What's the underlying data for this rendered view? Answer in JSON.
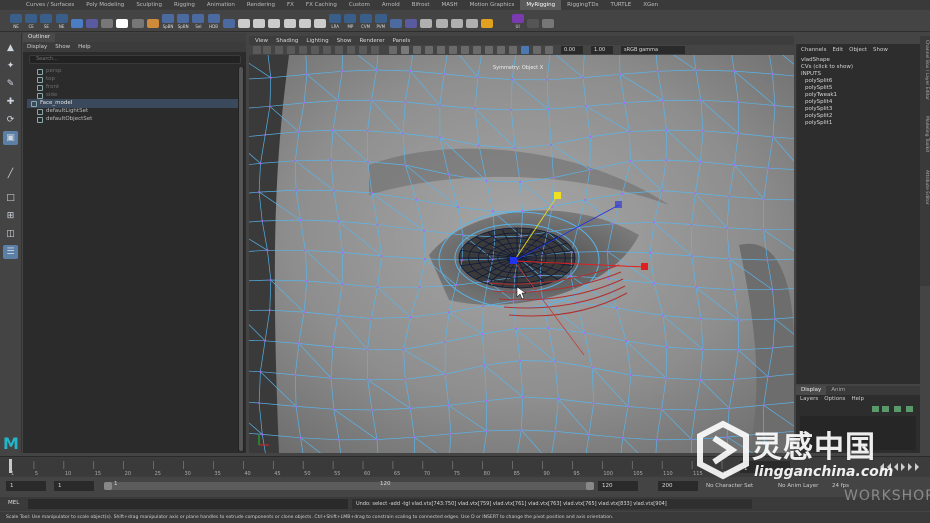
{
  "shelf_tabs": [
    "Curves / Surfaces",
    "Poly Modeling",
    "Sculpting",
    "Rigging",
    "Animation",
    "Rendering",
    "FX",
    "FX Caching",
    "Custom",
    "Arnold",
    "Bifrost",
    "MASH",
    "Motion Graphics",
    "MyRigging",
    "RiggingTDs",
    "TURTLE",
    "XGen"
  ],
  "shelf_active": "MyRigging",
  "shelf_icons": [
    {
      "label": "NE",
      "icon": "shelf-script-icon",
      "color": "#3a5e8a"
    },
    {
      "label": "CE",
      "icon": "shelf-script-icon",
      "color": "#3a5e8a"
    },
    {
      "label": "SE",
      "icon": "shelf-script-icon",
      "color": "#3a5e8a"
    },
    {
      "label": "NE",
      "icon": "shelf-script-icon",
      "color": "#3a5e8a"
    },
    {
      "label": "",
      "icon": "target-icon",
      "color": "#4b7dc4"
    },
    {
      "label": "",
      "icon": "grid-icon",
      "color": "#5a5aa0"
    },
    {
      "label": "",
      "icon": "checker-icon",
      "color": "#777777"
    },
    {
      "label": "",
      "icon": "dots-icon",
      "color": "#ffffff"
    },
    {
      "label": "",
      "icon": "checker-icon",
      "color": "#777777"
    },
    {
      "label": "",
      "icon": "joint-icon",
      "color": "#d08a3c"
    },
    {
      "label": "SpBN",
      "icon": "bone-icon",
      "color": "#4a6aa0"
    },
    {
      "label": "SpBN",
      "icon": "bone-icon",
      "color": "#4a6aa0"
    },
    {
      "label": "Sel",
      "icon": "select-icon",
      "color": "#4a6aa0"
    },
    {
      "label": "HDB",
      "icon": "bone-icon",
      "color": "#4a6aa0"
    },
    {
      "label": "",
      "icon": "bone-icon",
      "color": "#4a6aa0"
    },
    {
      "label": "",
      "icon": "tool-icon",
      "color": "#cccccc"
    },
    {
      "label": "",
      "icon": "tool-icon",
      "color": "#cccccc"
    },
    {
      "label": "",
      "icon": "tool-icon",
      "color": "#cccccc"
    },
    {
      "label": "",
      "icon": "tool-icon",
      "color": "#cccccc"
    },
    {
      "label": "",
      "icon": "tool-icon",
      "color": "#cccccc"
    },
    {
      "label": "",
      "icon": "tool-icon",
      "color": "#cccccc"
    },
    {
      "label": "LRA",
      "icon": "script-icon",
      "color": "#3a5e8a"
    },
    {
      "label": "MP",
      "icon": "script-icon",
      "color": "#3a5e8a"
    },
    {
      "label": "CVM",
      "icon": "script-icon",
      "color": "#3a5e8a"
    },
    {
      "label": "PVM",
      "icon": "script-icon",
      "color": "#3a5e8a"
    },
    {
      "label": "",
      "icon": "bone-icon",
      "color": "#4a6aa0"
    },
    {
      "label": "",
      "icon": "grid-icon",
      "color": "#5a5aa0"
    },
    {
      "label": "",
      "icon": "rig-icon",
      "color": "#b0b0b0"
    },
    {
      "label": "",
      "icon": "rig-icon",
      "color": "#b0b0b0"
    },
    {
      "label": "",
      "icon": "rig-icon",
      "color": "#b0b0b0"
    },
    {
      "label": "",
      "icon": "rig-icon",
      "color": "#b0b0b0"
    },
    {
      "label": "",
      "icon": "ring-icon",
      "color": "#e0a020"
    },
    {
      "label": "",
      "icon": "paint-icon",
      "color": "#444444"
    },
    {
      "label": "UI",
      "icon": "ui-icon",
      "color": "#7a3ab0"
    },
    {
      "label": "",
      "icon": "play-icon",
      "color": "#555555"
    },
    {
      "label": "",
      "icon": "bone-icon",
      "color": "#777777"
    },
    {
      "label": "",
      "icon": "menu-icon",
      "color": "#444444"
    }
  ],
  "outliner": {
    "title": "Outliner",
    "menu": [
      "Display",
      "Show",
      "Help"
    ],
    "search_placeholder": "Search...",
    "items": [
      {
        "label": "persp",
        "dim": true,
        "indent": 10
      },
      {
        "label": "top",
        "dim": true,
        "indent": 10
      },
      {
        "label": "front",
        "dim": true,
        "indent": 10
      },
      {
        "label": "side",
        "dim": true,
        "indent": 10
      },
      {
        "label": "Face_model",
        "dim": false,
        "indent": 4,
        "highlight": true
      },
      {
        "label": "defaultLightSet",
        "dim": false,
        "indent": 10
      },
      {
        "label": "defaultObjectSet",
        "dim": false,
        "indent": 10
      }
    ]
  },
  "viewport": {
    "menu": [
      "View",
      "Shading",
      "Lighting",
      "Show",
      "Renderer",
      "Panels"
    ],
    "exposure": "0.00",
    "gamma": "1.00",
    "colorspace": "sRGB gamma",
    "caption": "Symmetry: Object X"
  },
  "channel_box": {
    "menu": [
      "Channels",
      "Edit",
      "Object",
      "Show"
    ],
    "shape": "vladShape",
    "cvs": "CVs (click to show)",
    "inputs_label": "INPUTS",
    "inputs": [
      "polySplit6",
      "polySplit5",
      "polyTweak1",
      "polySplit4",
      "polySplit3",
      "polySplit2",
      "polySplit1"
    ]
  },
  "side_tabs": [
    "Channel Box / Layer Editor",
    "Modeling Toolkit",
    "Attribute Editor"
  ],
  "layer_editor": {
    "tabs": [
      "Display",
      "Anim"
    ],
    "active_tab": "Display",
    "menu": [
      "Layers",
      "Options",
      "Help"
    ]
  },
  "time_slider": {
    "ticks": [
      "1",
      "5",
      "10",
      "15",
      "20",
      "25",
      "30",
      "35",
      "40",
      "45",
      "50",
      "55",
      "60",
      "65",
      "70",
      "75",
      "80",
      "85",
      "90",
      "95",
      "100",
      "105",
      "110",
      "115",
      "120"
    ],
    "current_frame": "1"
  },
  "range": {
    "start": "1",
    "start2": "1",
    "slider_start": "1",
    "slider_end": "120",
    "end": "120",
    "end2": "200",
    "character_set": "No Character Set",
    "anim_layer": "No Anim Layer",
    "fps": "24 fps"
  },
  "command": {
    "mel": "MEL",
    "result": "Undo: select -add -tgl vlad.vtx[743:750] vlad.vtx[759] vlad.vtx[761] vlad.vtx[763] vlad.vtx[765] vlad.vtx[833] vlad.vtx[904]"
  },
  "help_line": "Scale Tool: Use manipulator to scale object(s). Shift+drag manipulator axis or plane handles to extrude components or clone objects. Ctrl+Shift+LMB+drag to constrain scaling to connected edges. Use D or INSERT to change the pivot position and axis orientation.",
  "watermark": {
    "line1": "灵感中国",
    "line2": "lingganchina.com",
    "line3": "WORKSHOP"
  },
  "colors": {
    "wire": "#57b7ee",
    "mesh": "#8b8b8b",
    "selection": "#5b7fa5",
    "manip_x": "#e02020",
    "manip_y": "#e0d020",
    "manip_z": "#2030e0"
  }
}
